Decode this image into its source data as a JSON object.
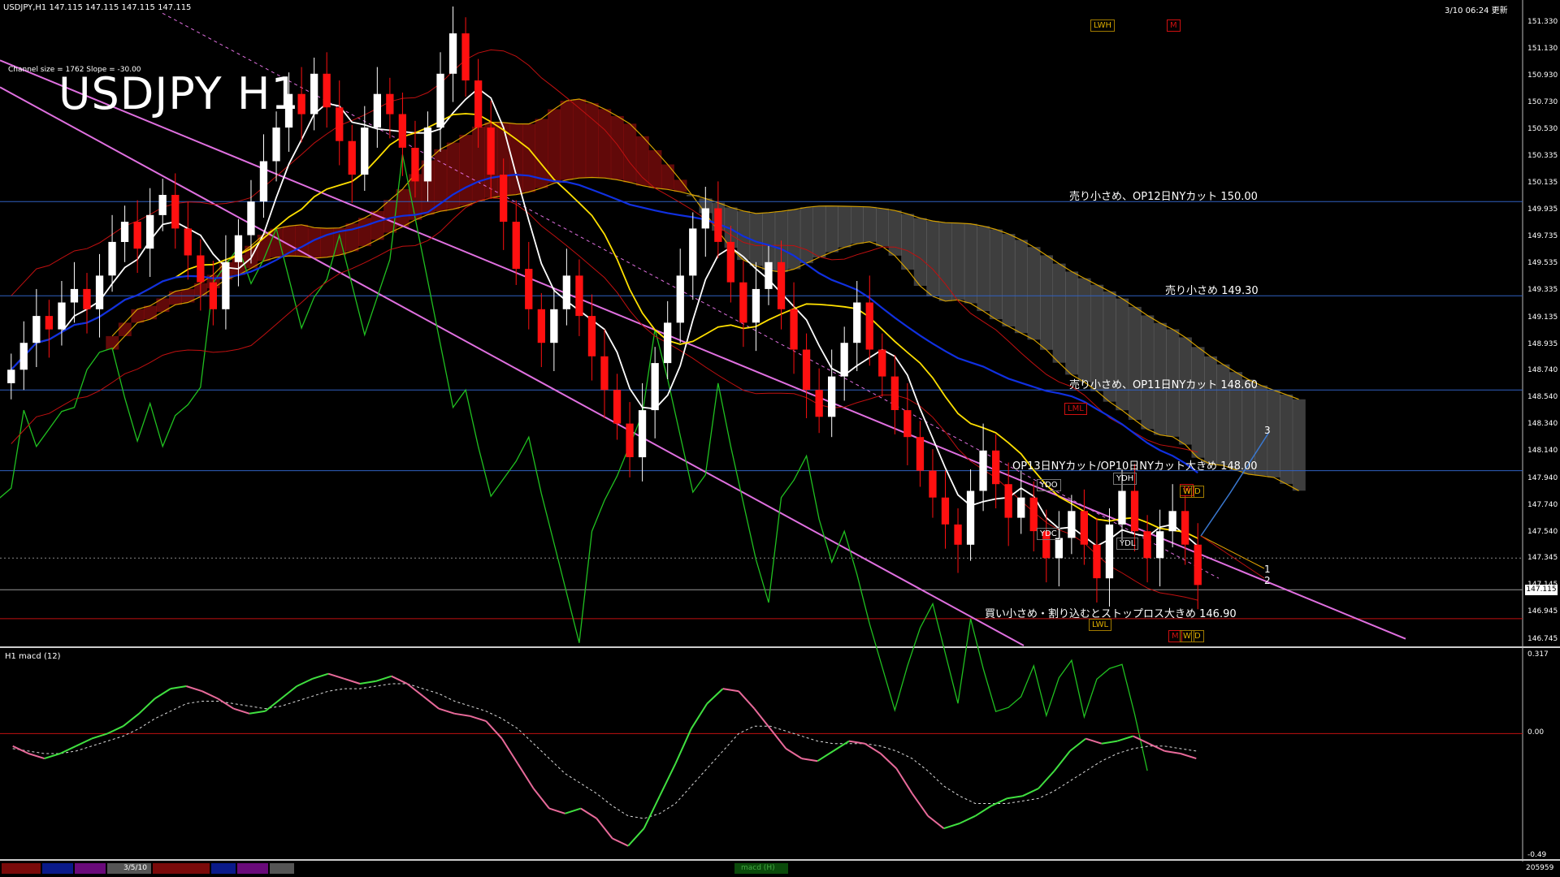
{
  "header": {
    "symbol_line": "USDJPY,H1  147.115 147.115 147.115 147.115",
    "updated": "3/10 06:24 更新",
    "channel_info": "Channel size = 1762 Slope = -30.00",
    "big_title": "USDJPY H1"
  },
  "macd_panel": {
    "label": "H1  macd (12)",
    "top_value": "0.317",
    "zero_value": "0.00",
    "bottom_value": "-0.49"
  },
  "bottom_bar": {
    "number_left": "3/5/10",
    "right_value": "205959",
    "tab_label": "macd (H)"
  },
  "current_price": "147.115",
  "price_ticks": [
    "151.330",
    "151.130",
    "150.930",
    "150.730",
    "150.530",
    "150.335",
    "150.135",
    "149.935",
    "149.735",
    "149.535",
    "149.335",
    "149.135",
    "148.935",
    "148.740",
    "148.540",
    "148.340",
    "148.140",
    "147.940",
    "147.740",
    "147.540",
    "147.345",
    "147.145",
    "146.945",
    "146.745"
  ],
  "levels": [
    {
      "label": "売り小さめ、OP12日NYカット 150.00",
      "price": 150.0
    },
    {
      "label": "売り小さめ 149.30",
      "price": 149.3
    },
    {
      "label": "売り小さめ、OP11日NYカット 148.60",
      "price": 148.6
    },
    {
      "label": "OP13日NYカット/OP10日NYカット大きめ 148.00",
      "price": 148.0
    },
    {
      "label": "買い小さめ・割り込むとストップロス大きめ 146.90",
      "price": 146.9
    }
  ],
  "tags": [
    {
      "text": "LWH",
      "style": "gold"
    },
    {
      "text": "M",
      "style": "red"
    },
    {
      "text": "LML",
      "style": "red"
    },
    {
      "text": "YDO",
      "style": "white"
    },
    {
      "text": "YDH",
      "style": "white"
    },
    {
      "text": "YDC",
      "style": "white"
    },
    {
      "text": "YDL",
      "style": "white"
    },
    {
      "text": "LWL",
      "style": "gold"
    },
    {
      "text": "M",
      "style": "red"
    },
    {
      "text": "W",
      "style": "gold"
    },
    {
      "text": "D",
      "style": "gold"
    },
    {
      "text": "M",
      "style": "red"
    },
    {
      "text": "W",
      "style": "gold"
    },
    {
      "text": "D",
      "style": "gold"
    }
  ],
  "wave_labels": [
    "1",
    "2",
    "3"
  ],
  "colors": {
    "bull": "#ffffff",
    "bear": "#ff1010",
    "ma_fast": "#ffffff",
    "ma_mid": "#ffe000",
    "ma_slow": "#1030e0",
    "channel": "#e070e0",
    "kumo_red": "#b01010",
    "kumo_white": "#dddddd",
    "chikou": "#20c020",
    "span_line": "#d4a000",
    "macd_up": "#40e040",
    "macd_down": "#e86a9a",
    "level_line": "#3060c0"
  },
  "chart_data": {
    "type": "candlestick",
    "symbol": "USDJPY",
    "timeframe": "H1",
    "ylim": [
      146.7,
      151.45
    ],
    "closes": [
      148.75,
      148.95,
      149.15,
      149.05,
      149.25,
      149.35,
      149.2,
      149.45,
      149.7,
      149.85,
      149.65,
      149.9,
      150.05,
      149.8,
      149.6,
      149.4,
      149.2,
      149.55,
      149.75,
      150.0,
      150.3,
      150.55,
      150.8,
      150.65,
      150.95,
      150.7,
      150.45,
      150.2,
      150.55,
      150.8,
      150.65,
      150.4,
      150.15,
      150.55,
      150.95,
      151.25,
      150.9,
      150.55,
      150.2,
      149.85,
      149.5,
      149.2,
      148.95,
      149.2,
      149.45,
      149.15,
      148.85,
      148.6,
      148.35,
      148.1,
      148.45,
      148.8,
      149.1,
      149.45,
      149.8,
      149.95,
      149.7,
      149.4,
      149.1,
      149.35,
      149.55,
      149.2,
      148.9,
      148.6,
      148.4,
      148.7,
      148.95,
      149.25,
      148.9,
      148.7,
      148.45,
      148.25,
      148.0,
      147.8,
      147.6,
      147.45,
      147.85,
      148.15,
      147.9,
      147.65,
      147.8,
      147.55,
      147.35,
      147.5,
      147.7,
      147.45,
      147.2,
      147.6,
      147.85,
      147.55,
      147.35,
      147.55,
      147.7,
      147.45,
      147.15
    ]
  },
  "macd_data": {
    "ylim": [
      -0.49,
      0.317
    ],
    "macd": [
      -0.05,
      -0.08,
      -0.1,
      -0.08,
      -0.05,
      -0.02,
      0.0,
      0.03,
      0.08,
      0.14,
      0.18,
      0.19,
      0.17,
      0.14,
      0.1,
      0.08,
      0.09,
      0.14,
      0.19,
      0.22,
      0.24,
      0.22,
      0.2,
      0.21,
      0.23,
      0.2,
      0.15,
      0.1,
      0.08,
      0.07,
      0.05,
      -0.02,
      -0.12,
      -0.22,
      -0.3,
      -0.32,
      -0.3,
      -0.34,
      -0.42,
      -0.45,
      -0.38,
      -0.25,
      -0.12,
      0.02,
      0.12,
      0.18,
      0.17,
      0.1,
      0.02,
      -0.06,
      -0.1,
      -0.11,
      -0.07,
      -0.03,
      -0.04,
      -0.08,
      -0.14,
      -0.24,
      -0.33,
      -0.38,
      -0.36,
      -0.33,
      -0.29,
      -0.26,
      -0.25,
      -0.22,
      -0.15,
      -0.07,
      -0.02,
      -0.04,
      -0.03,
      -0.01,
      -0.04,
      -0.07,
      -0.08,
      -0.1
    ],
    "signal": [
      -0.06,
      -0.07,
      -0.08,
      -0.08,
      -0.07,
      -0.05,
      -0.03,
      -0.01,
      0.02,
      0.06,
      0.09,
      0.12,
      0.13,
      0.13,
      0.12,
      0.11,
      0.1,
      0.11,
      0.13,
      0.15,
      0.17,
      0.18,
      0.18,
      0.19,
      0.2,
      0.2,
      0.18,
      0.16,
      0.13,
      0.11,
      0.09,
      0.06,
      0.02,
      -0.04,
      -0.1,
      -0.16,
      -0.2,
      -0.24,
      -0.29,
      -0.33,
      -0.34,
      -0.32,
      -0.28,
      -0.21,
      -0.14,
      -0.07,
      0.0,
      0.03,
      0.03,
      0.01,
      -0.01,
      -0.03,
      -0.04,
      -0.04,
      -0.04,
      -0.05,
      -0.07,
      -0.1,
      -0.15,
      -0.21,
      -0.25,
      -0.28,
      -0.28,
      -0.28,
      -0.27,
      -0.26,
      -0.23,
      -0.19,
      -0.15,
      -0.11,
      -0.08,
      -0.06,
      -0.05,
      -0.05,
      -0.06,
      -0.07
    ]
  }
}
